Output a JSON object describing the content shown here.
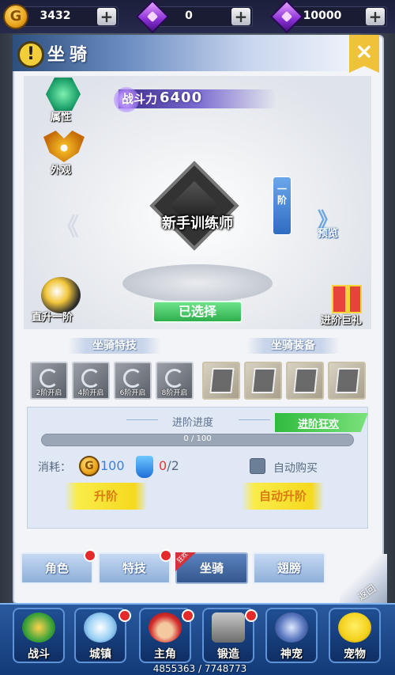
{
  "currency": {
    "gold": {
      "value": "3432",
      "icon": "G"
    },
    "gem": {
      "value": "0"
    },
    "bound_gem": {
      "value": "10000"
    },
    "plus": "+"
  },
  "header": {
    "title": "坐骑",
    "close": "×"
  },
  "side_left": {
    "attr": "属性",
    "look": "外观",
    "direct_up": "直升一阶"
  },
  "power": {
    "label": "战斗力",
    "value": "6400"
  },
  "rank": {
    "name": "新手训练师",
    "step_vertical": "一\n阶"
  },
  "nav": {
    "left_arrow": "《",
    "right_arrow": "》",
    "preview": "预览"
  },
  "selected_button": "已选择",
  "gift_label": "进阶巨礼",
  "sections": {
    "skills_title": "坐骑特技",
    "equip_title": "坐骑装备"
  },
  "skills": [
    {
      "label": "2阶开启"
    },
    {
      "label": "4阶开启"
    },
    {
      "label": "6阶开启"
    },
    {
      "label": "8阶开启"
    }
  ],
  "progress": {
    "title": "进阶进度",
    "crazy_label": "进阶狂欢",
    "current": 0,
    "max": 100,
    "text": "0 / 100"
  },
  "cost": {
    "label": "消耗：",
    "coin_icon": "G",
    "coin_amount": "100",
    "item_have": "0",
    "item_need": "/2"
  },
  "auto_buy_label": "自动购买",
  "buttons": {
    "upgrade": "升阶",
    "auto_upgrade": "自动升阶"
  },
  "tabs": [
    {
      "label": "角色"
    },
    {
      "label": "特技"
    },
    {
      "label": "坐骑"
    },
    {
      "label": "翅膀"
    }
  ],
  "ribbon_label": "狂欢",
  "back_label": "返回",
  "bottom_nav": [
    {
      "label": "战斗",
      "icon": "battle-icon"
    },
    {
      "label": "城镇",
      "icon": "town-icon"
    },
    {
      "label": "主角",
      "icon": "hero-icon"
    },
    {
      "label": "锻造",
      "icon": "forge-icon"
    },
    {
      "label": "神宠",
      "icon": "divine-pet-icon"
    },
    {
      "label": "宠物",
      "icon": "pet-icon"
    }
  ],
  "hp_text": "4855363 / 7748773",
  "colors": {
    "accent_green": "#2fae4d",
    "accent_blue": "#34578e",
    "gold": "#e9a41a"
  }
}
